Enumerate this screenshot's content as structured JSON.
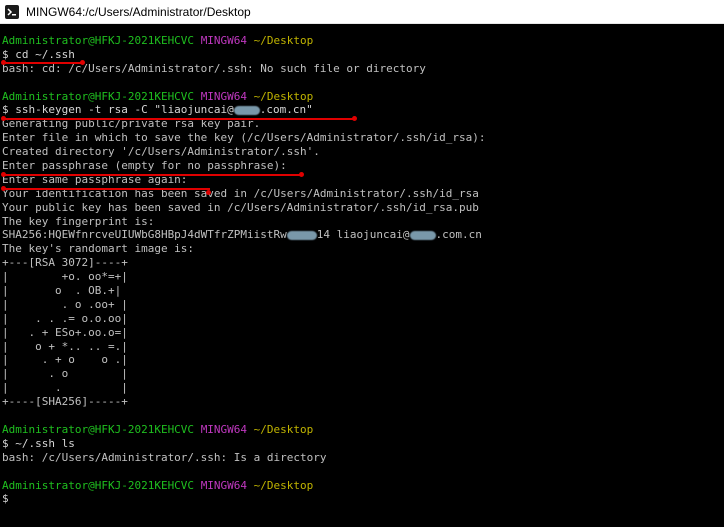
{
  "window": {
    "title": "MINGW64:/c/Users/Administrator/Desktop",
    "icon": "git-bash-icon"
  },
  "prompt": {
    "user_host": "Administrator@HFKJ-2021KEHCVC",
    "env": "MINGW64",
    "path": "~/Desktop"
  },
  "blocks": [
    {
      "cmd": "$ cd ~/.ssh",
      "output": [
        "bash: cd: /c/Users/Administrator/.ssh: No such file or directory"
      ]
    },
    {
      "cmd_prefix": "$ ssh-keygen -t rsa -C \"liaojuncai@",
      "cmd_suffix": ".com.cn\"",
      "output": [
        "Generating public/private rsa key pair.",
        "Enter file in which to save the key (/c/Users/Administrator/.ssh/id_rsa):",
        "Created directory '/c/Users/Administrator/.ssh'.",
        "Enter passphrase (empty for no passphrase):",
        "Enter same passphrase again:",
        "Your identification has been saved in /c/Users/Administrator/.ssh/id_rsa",
        "Your public key has been saved in /c/Users/Administrator/.ssh/id_rsa.pub",
        "The key fingerprint is:"
      ],
      "fingerprint_prefix": "SHA256:HQEWfnrcveUIUWbG8HBpJ4dWTfrZPMiistRw",
      "fingerprint_mid": "14 liaojuncai@",
      "fingerprint_suffix": ".com.cn",
      "art_header": "The key's randomart image is:",
      "randomart": [
        "+---[RSA 3072]----+",
        "|        +o. oo*=+|",
        "|       o  . OB.+|",
        "|        . o .oo+ |",
        "|    . . .= o.o.oo|",
        "|   . + ESo+.oo.o=|",
        "|    o + *.. .. =.|",
        "|     . + o    o .|",
        "|      . o        |",
        "|       .         |",
        "+----[SHA256]-----+"
      ]
    },
    {
      "cmd": "$ ~/.ssh ls",
      "output": [
        "bash: /c/Users/Administrator/.ssh: Is a directory"
      ]
    }
  ],
  "final_prompt": "$",
  "colors": {
    "user": "#1fbf1f",
    "env": "#c038c0",
    "path": "#c0b400",
    "annotation": "#e00000"
  }
}
